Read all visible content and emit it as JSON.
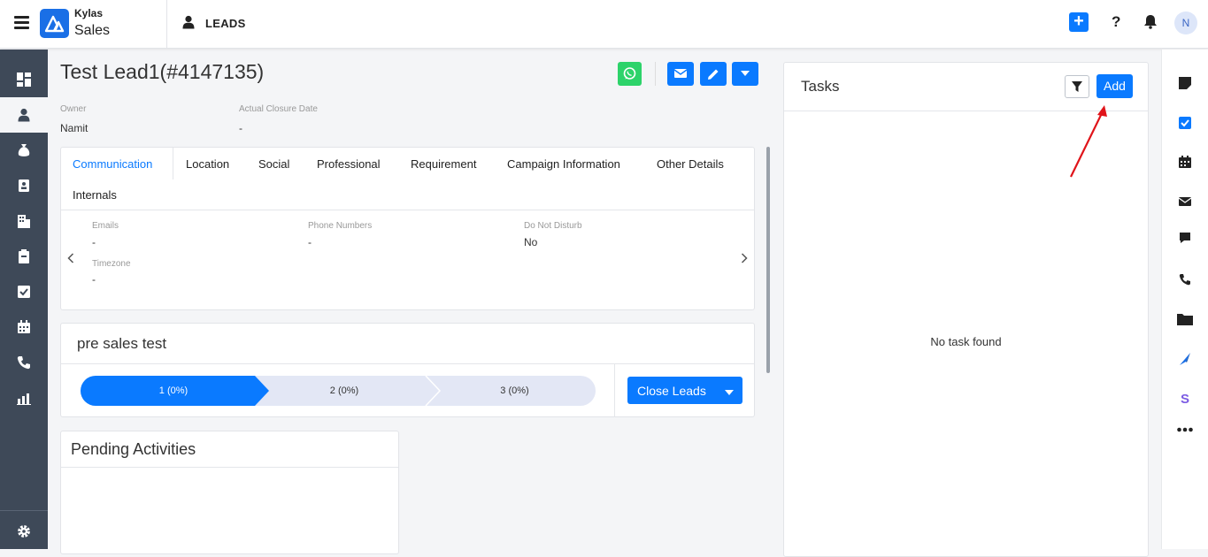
{
  "app": {
    "brand_top": "Kylas",
    "brand_bottom": "Sales",
    "section": "LEADS",
    "avatar_initial": "N"
  },
  "header_icons": [
    "menu-icon",
    "kylas-logo-icon",
    "user-icon",
    "add-icon",
    "help-icon",
    "bell-icon",
    "avatar"
  ],
  "lead": {
    "title": "Test Lead1(#4147135)",
    "owner_label": "Owner",
    "owner_value": "Namit",
    "closure_label": "Actual Closure Date",
    "closure_value": "-"
  },
  "tabs": [
    "Communication",
    "Location",
    "Social",
    "Professional",
    "Requirement",
    "Campaign Information",
    "Other Details",
    "Internals"
  ],
  "communication": {
    "emails_label": "Emails",
    "emails_value": "-",
    "phones_label": "Phone Numbers",
    "phones_value": "-",
    "dnd_label": "Do Not Disturb",
    "dnd_value": "No",
    "timezone_label": "Timezone",
    "timezone_value": "-"
  },
  "pipeline": {
    "name": "pre sales test",
    "stages": [
      "1 (0%)",
      "2 (0%)",
      "3 (0%)"
    ],
    "close_button": "Close Leads"
  },
  "pending": {
    "title": "Pending Activities"
  },
  "tasks": {
    "title": "Tasks",
    "add_label": "Add",
    "empty_text": "No task found"
  },
  "colors": {
    "accent": "#0a7aff",
    "sidebar": "#3e4958",
    "whatsapp": "#2dd36a",
    "stage_active": "#0a7aff",
    "stage_inactive": "#e3e7f5",
    "annotation_arrow": "#e0141a"
  }
}
